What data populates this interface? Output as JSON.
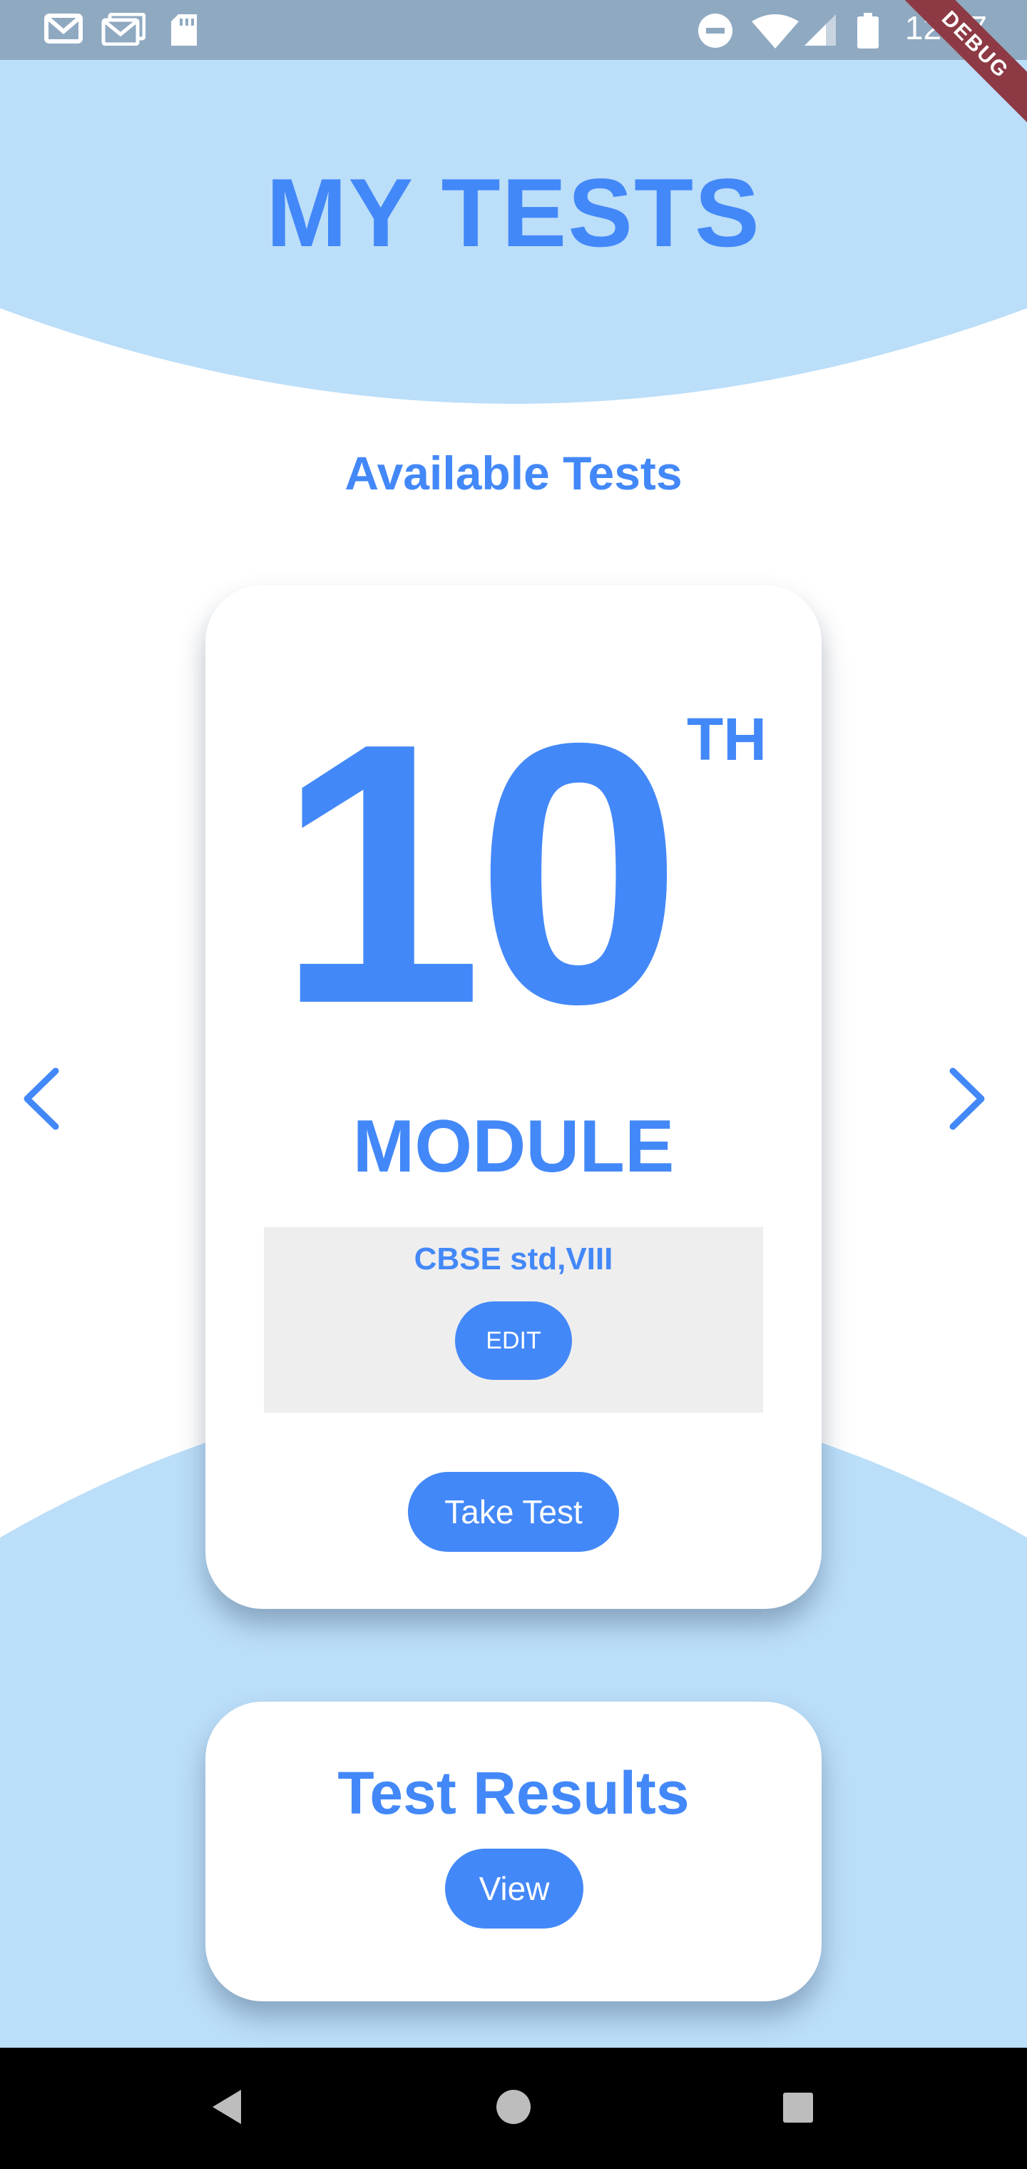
{
  "status_bar": {
    "time": "12:07",
    "debug_banner": "DEBUG",
    "left_icons": [
      "gmail-icon",
      "gmail-icon",
      "sd-card-icon"
    ],
    "right_icons": [
      "do-not-disturb-icon",
      "wifi-icon",
      "signal-icon",
      "battery-icon"
    ],
    "background_color": "#8fa9c1"
  },
  "header": {
    "title": "MY TESTS"
  },
  "available": {
    "title": "Available Tests",
    "prev_icon": "chevron-left-icon",
    "next_icon": "chevron-right-icon"
  },
  "module_card": {
    "number": "10",
    "suffix": "TH",
    "label": "MODULE",
    "board": "CBSE std,VIII",
    "edit_label": "EDIT",
    "take_test_label": "Take Test"
  },
  "results_card": {
    "title": "Test Results",
    "view_label": "View"
  },
  "nav_bar": {
    "icons": [
      "back-icon",
      "home-icon",
      "recents-icon"
    ]
  },
  "colors": {
    "accent": "#4388f8",
    "light_blue": "#bbdef9",
    "panel_gray": "#eeeeee",
    "white": "#ffffff"
  }
}
